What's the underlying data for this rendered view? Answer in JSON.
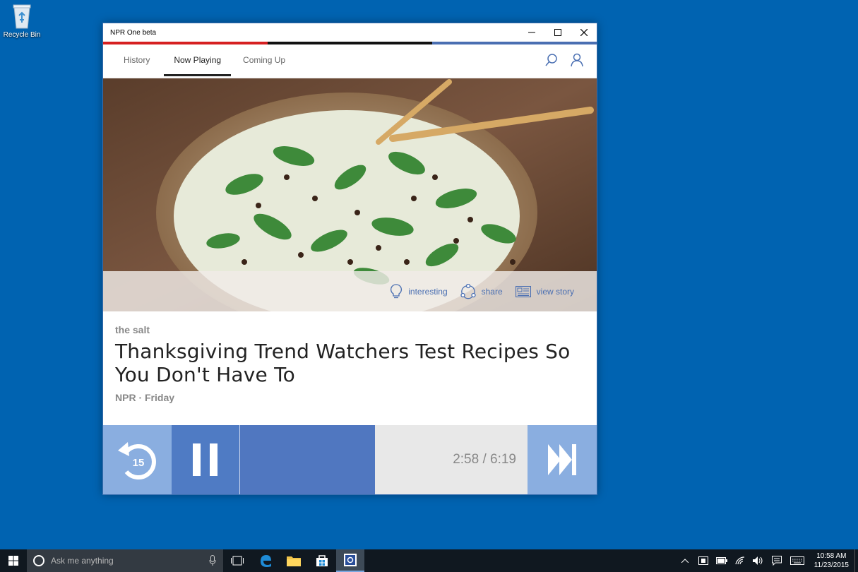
{
  "desktop": {
    "recycle_bin_label": "Recycle Bin"
  },
  "window": {
    "title": "NPR One beta",
    "brand_colors": [
      "#d62021",
      "#111111",
      "#4a6fb2"
    ]
  },
  "tabs": [
    {
      "label": "History"
    },
    {
      "label": "Now Playing",
      "active": true
    },
    {
      "label": "Coming Up"
    }
  ],
  "actions": {
    "interesting": "interesting",
    "share": "share",
    "view_story": "view story"
  },
  "story": {
    "program": "the salt",
    "headline": "Thanksgiving Trend Watchers Test Recipes So You Don't Have To",
    "meta": "NPR · Friday"
  },
  "player": {
    "rewind_seconds": "15",
    "time_display": "2:58 / 6:19",
    "progress_fraction": 0.469
  },
  "taskbar": {
    "search_placeholder": "Ask me anything",
    "clock_time": "10:58 AM",
    "clock_date": "11/23/2015"
  }
}
